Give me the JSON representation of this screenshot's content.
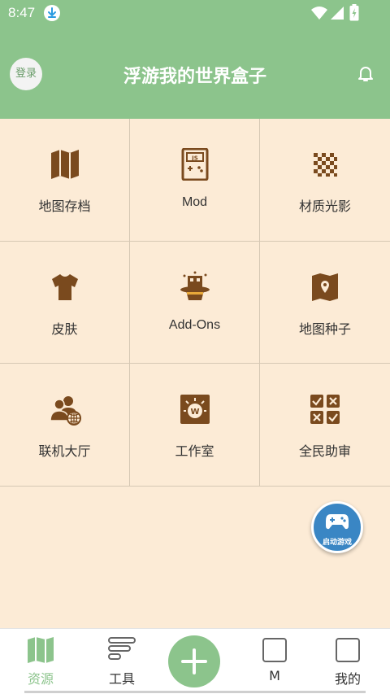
{
  "status_bar": {
    "time": "8:47"
  },
  "header": {
    "login_label": "登录",
    "title": "浮游我的世界盒子"
  },
  "grid": {
    "items": [
      {
        "label": "地图存档",
        "icon": "map-icon"
      },
      {
        "label": "Mod",
        "icon": "js-device-icon"
      },
      {
        "label": "材质光影",
        "icon": "checker-texture-icon"
      },
      {
        "label": "皮肤",
        "icon": "shirt-icon"
      },
      {
        "label": "Add-Ons",
        "icon": "magic-hat-icon"
      },
      {
        "label": "地图种子",
        "icon": "map-seed-icon"
      },
      {
        "label": "联机大厅",
        "icon": "multiplayer-icon"
      },
      {
        "label": "工作室",
        "icon": "studio-icon"
      },
      {
        "label": "全民助审",
        "icon": "review-checklist-icon"
      }
    ]
  },
  "fab": {
    "label": "启动游戏",
    "icon": "gamepad-icon"
  },
  "bottom_nav": {
    "resources": "资源",
    "tools": "工具",
    "add_icon": "plus-icon",
    "m_tab": "M",
    "mine": "我的"
  },
  "colors": {
    "accent": "#8cc48c",
    "background": "#fcebd6",
    "icon_brown": "#7a4a1e",
    "fab_blue": "#3a86c4"
  }
}
